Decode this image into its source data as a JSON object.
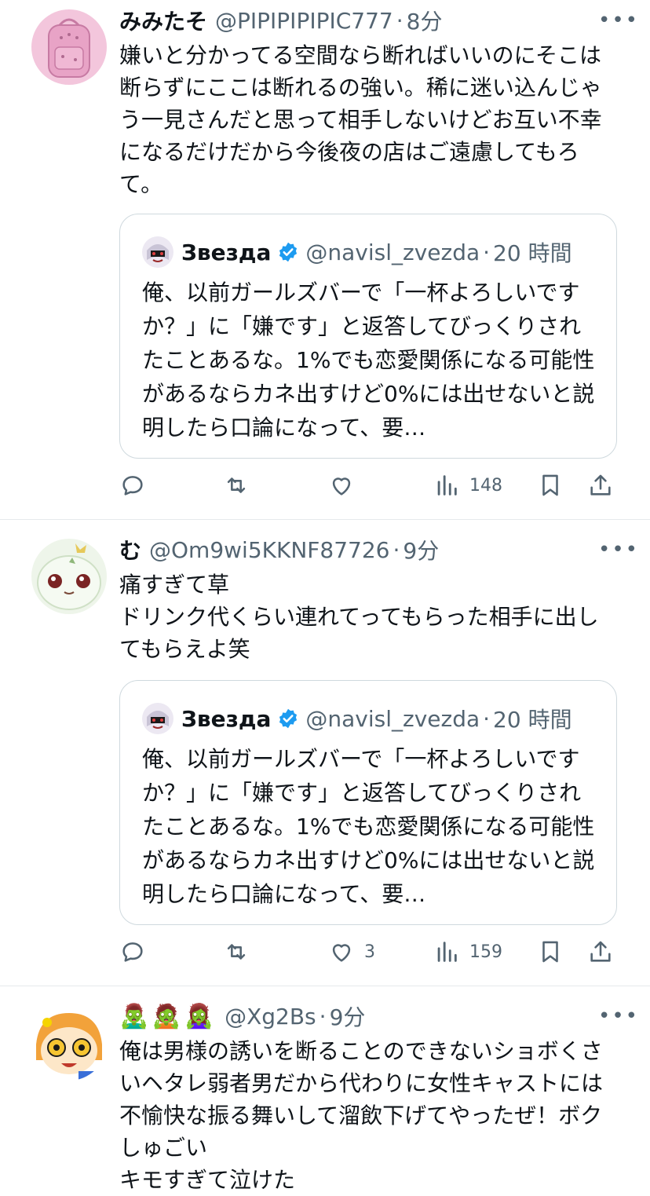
{
  "tweets": [
    {
      "name": "みみたそ",
      "handle": "@PIPIPIPIPIC777",
      "separator": "·",
      "time": "8分",
      "text": "嫌いと分かってる空間なら断ればいいのにそこは断らずにここは断れるの強い。稀に迷い込んじゃう一見さんだと思って相手しないけどお互い不幸になるだけだから今後夜の店はご遠慮してもろて。",
      "quote": {
        "name": "Звезда",
        "handle": "@navisl_zvezda",
        "separator": "·",
        "time": "20 時間",
        "text": "俺、以前ガールズバーで「一杯よろしいですか？」に「嫌です」と返答してびっくりされたことあるな。1%でも恋愛関係になる可能性があるならカネ出すけど0%には出せないと説明したら口論になって、要…"
      },
      "actions": {
        "reply": "",
        "retweet": "",
        "like": "",
        "views": "148"
      }
    },
    {
      "name": "む",
      "handle": "@Om9wi5KKNF87726",
      "separator": "·",
      "time": "9分",
      "text": "痛すぎて草\nドリンク代くらい連れてってもらった相手に出してもらえよ笑",
      "quote": {
        "name": "Звезда",
        "handle": "@navisl_zvezda",
        "separator": "·",
        "time": "20 時間",
        "text": "俺、以前ガールズバーで「一杯よろしいですか？」に「嫌です」と返答してびっくりされたことあるな。1%でも恋愛関係になる可能性があるならカネ出すけど0%には出せないと説明したら口論になって、要…"
      },
      "actions": {
        "reply": "",
        "retweet": "",
        "like": "3",
        "views": "159"
      }
    },
    {
      "name_emoji": [
        "🧟‍♂️",
        "🧟",
        "🧟‍♀️"
      ],
      "handle": "@Xg2Bs",
      "separator": "·",
      "time": "9分",
      "text": "俺は男様の誘いを断ることのできないショボくさいヘタレ弱者男だから代わりに女性キャストには不愉快な振る舞いして溜飲下げてやったぜ！ボクしゅごい\nキモすぎて泣けた"
    }
  ],
  "more_label": "•••",
  "colors": {
    "accent": "#1d9bf0",
    "secondary_text": "#536471",
    "border": "#cfd9de"
  }
}
